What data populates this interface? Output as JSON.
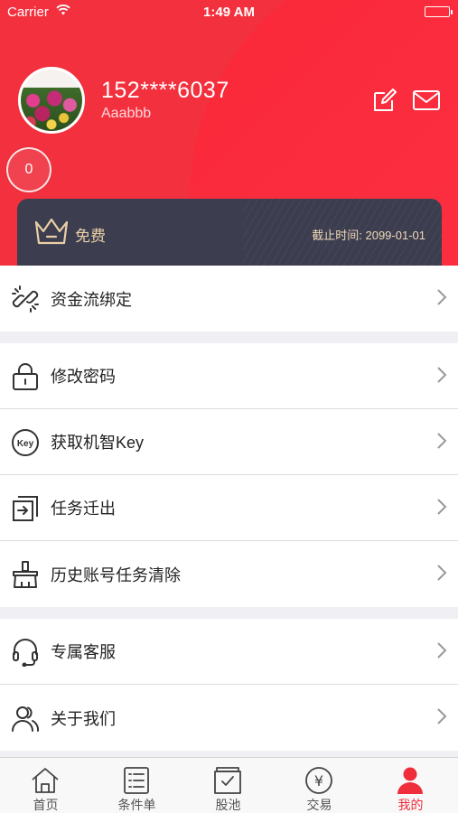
{
  "status_bar": {
    "carrier": "Carrier",
    "time": "1:49 AM"
  },
  "profile": {
    "phone": "152****6037",
    "nickname": "Aaabbb",
    "badge_count": "0"
  },
  "vip_card": {
    "level": "免费",
    "expire": "截止时间: 2099-01-01",
    "icon": "crown-icon"
  },
  "menu": {
    "fund_binding": {
      "label": "资金流绑定",
      "icon": "chain-link-icon"
    },
    "change_password": {
      "label": "修改密码",
      "icon": "lock-icon"
    },
    "get_key": {
      "label": "获取机智Key",
      "icon": "key-badge-icon",
      "icon_text": "Key"
    },
    "task_export": {
      "label": "任务迁出",
      "icon": "export-icon"
    },
    "history_clear": {
      "label": "历史账号任务清除",
      "icon": "broom-icon"
    },
    "customer_service": {
      "label": "专属客服",
      "icon": "headset-icon"
    },
    "about_us": {
      "label": "关于我们",
      "icon": "people-icon"
    }
  },
  "tabbar": {
    "home": {
      "label": "首页",
      "icon": "home-icon"
    },
    "conditions": {
      "label": "条件单",
      "icon": "list-icon"
    },
    "stock_pool": {
      "label": "股池",
      "icon": "checkbox-tray-icon"
    },
    "trade": {
      "label": "交易",
      "icon": "yen-circle-icon",
      "icon_text": "¥"
    },
    "mine": {
      "label": "我的",
      "icon": "user-icon",
      "active": true
    }
  },
  "colors": {
    "brand_red": "#f2303e",
    "card_dark": "#3c3d4f",
    "card_gold": "#eacfa6",
    "active_tab": "#ef2d3b"
  }
}
